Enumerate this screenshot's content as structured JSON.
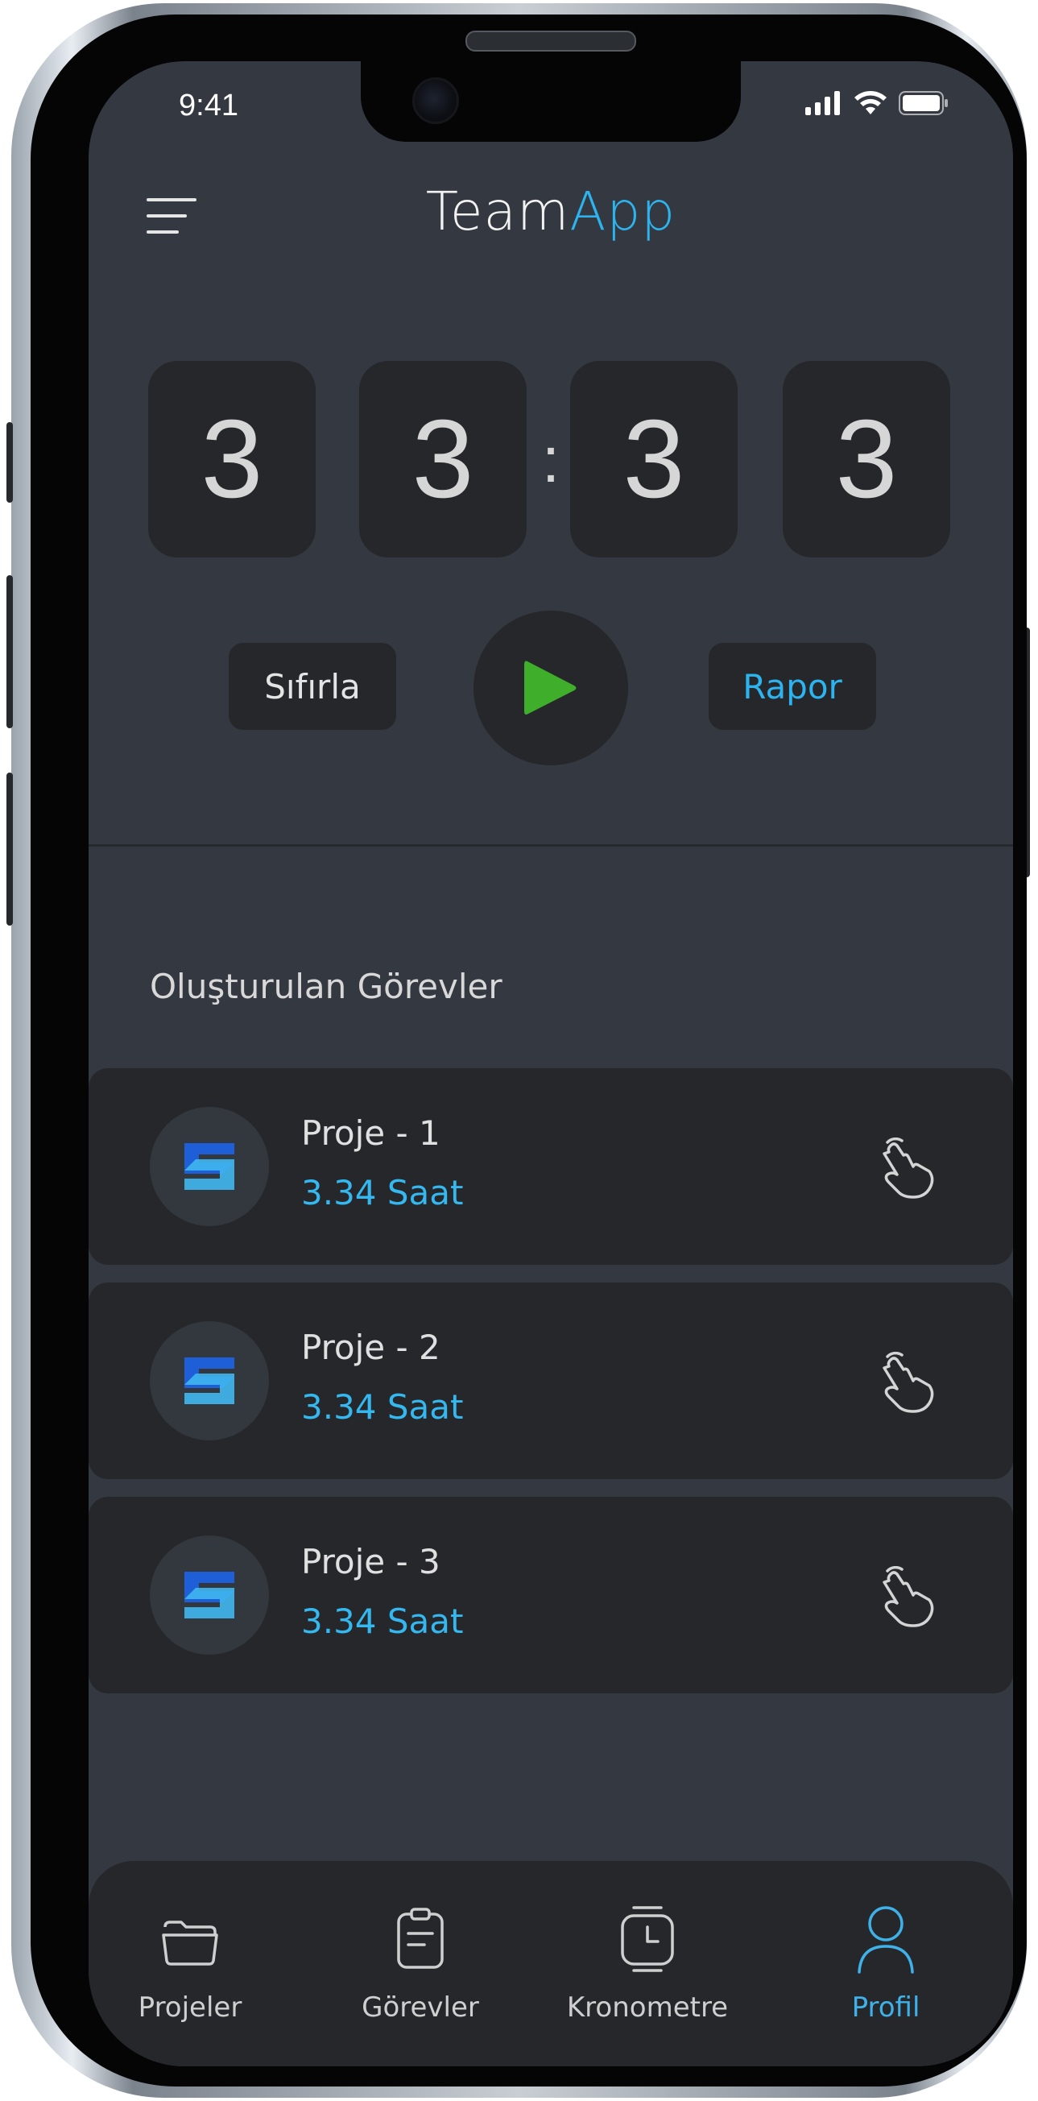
{
  "status_bar": {
    "time": "9:41"
  },
  "header": {
    "brand_part1": "Team",
    "brand_part2": "App",
    "menu_icon": "hamburger-icon"
  },
  "timer": {
    "digits": [
      "3",
      "3",
      "3",
      "3"
    ],
    "separator": ":"
  },
  "controls": {
    "reset_label": "Sıfırla",
    "play_icon": "play-icon",
    "report_label": "Rapor"
  },
  "tasks_section": {
    "title": "Oluşturulan Görevler",
    "items": [
      {
        "name": "Proje - 1",
        "hours": "3.34 Saat",
        "icon": "project-logo-icon",
        "action_icon": "tap-hand-icon"
      },
      {
        "name": "Proje - 2",
        "hours": "3.34 Saat",
        "icon": "project-logo-icon",
        "action_icon": "tap-hand-icon"
      },
      {
        "name": "Proje - 3",
        "hours": "3.34 Saat",
        "icon": "project-logo-icon",
        "action_icon": "tap-hand-icon"
      }
    ]
  },
  "bottom_nav": {
    "items": [
      {
        "label": "Projeler",
        "icon": "folder-icon",
        "active": false
      },
      {
        "label": "Görevler",
        "icon": "clipboard-icon",
        "active": false
      },
      {
        "label": "Kronometre",
        "icon": "stopwatch-icon",
        "active": false
      },
      {
        "label": "Profil",
        "icon": "user-icon",
        "active": true
      }
    ]
  },
  "colors": {
    "screen_bg": "#343840",
    "card_bg": "#25272b",
    "accent": "#2db3ee",
    "play": "#3fae2a"
  }
}
